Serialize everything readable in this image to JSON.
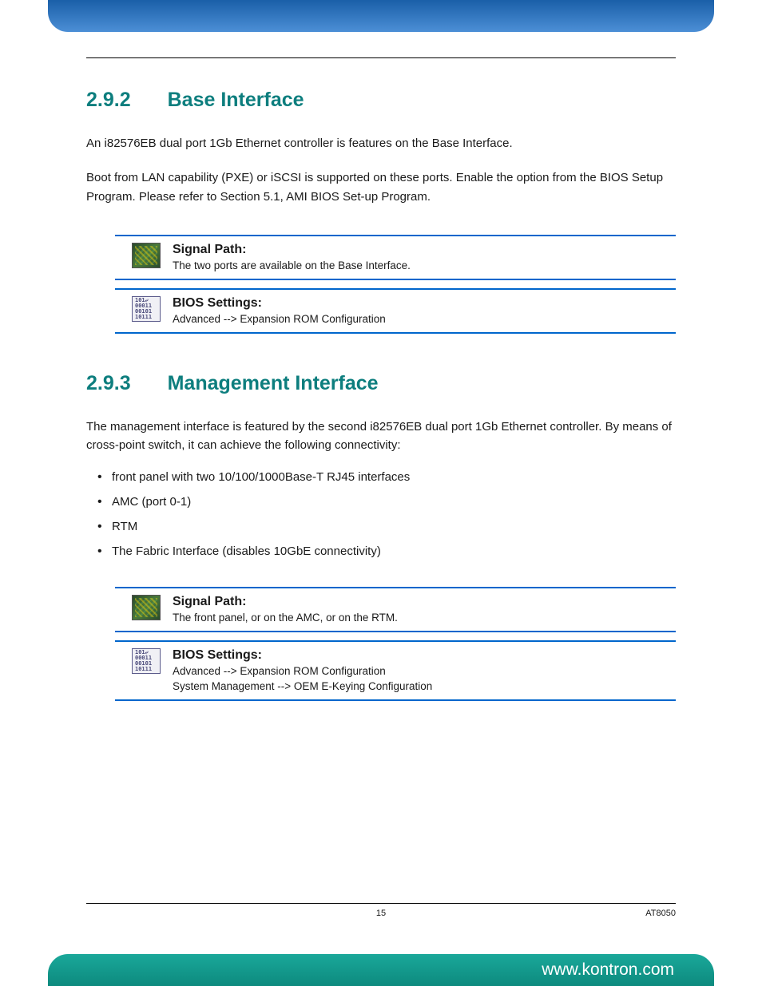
{
  "sections": [
    {
      "number": "2.9.2",
      "title": "Base Interface",
      "paragraphs": [
        "An i82576EB dual port 1Gb Ethernet controller is features on the Base Interface.",
        "Boot from LAN capability (PXE) or iSCSI is supported on these ports. Enable the option from the BIOS Setup Program. Please refer to Section 5.1, AMI BIOS Set-up Program."
      ],
      "info_rows": [
        {
          "icon_type": "signal",
          "title": "Signal Path:",
          "lines": [
            "The two ports are available on the Base Interface."
          ]
        },
        {
          "icon_type": "bios",
          "title": "BIOS Settings:",
          "lines": [
            "Advanced --> Expansion ROM Configuration"
          ]
        }
      ]
    },
    {
      "number": "2.9.3",
      "title": "Management Interface",
      "paragraphs": [
        "The management interface is featured by the second i82576EB dual port 1Gb Ethernet controller. By means of cross-point switch, it can achieve the following connectivity:"
      ],
      "bullets": [
        "front panel with two 10/100/1000Base-T RJ45 interfaces",
        "AMC (port 0-1)",
        "RTM",
        "The Fabric Interface (disables 10GbE connectivity)"
      ],
      "info_rows": [
        {
          "icon_type": "signal",
          "title": "Signal Path:",
          "lines": [
            "The front panel, or on the AMC, or on the RTM."
          ]
        },
        {
          "icon_type": "bios",
          "title": "BIOS Settings:",
          "lines": [
            "Advanced --> Expansion ROM Configuration",
            "System Management --> OEM E-Keying Configuration"
          ]
        }
      ]
    }
  ],
  "footer": {
    "page_number": "15",
    "doc_id": "AT8050",
    "url": "www.kontron.com"
  },
  "bios_icon_text": {
    "line1": "101⤶",
    "line2": "00011",
    "line3": "00101",
    "line4": "10111"
  }
}
